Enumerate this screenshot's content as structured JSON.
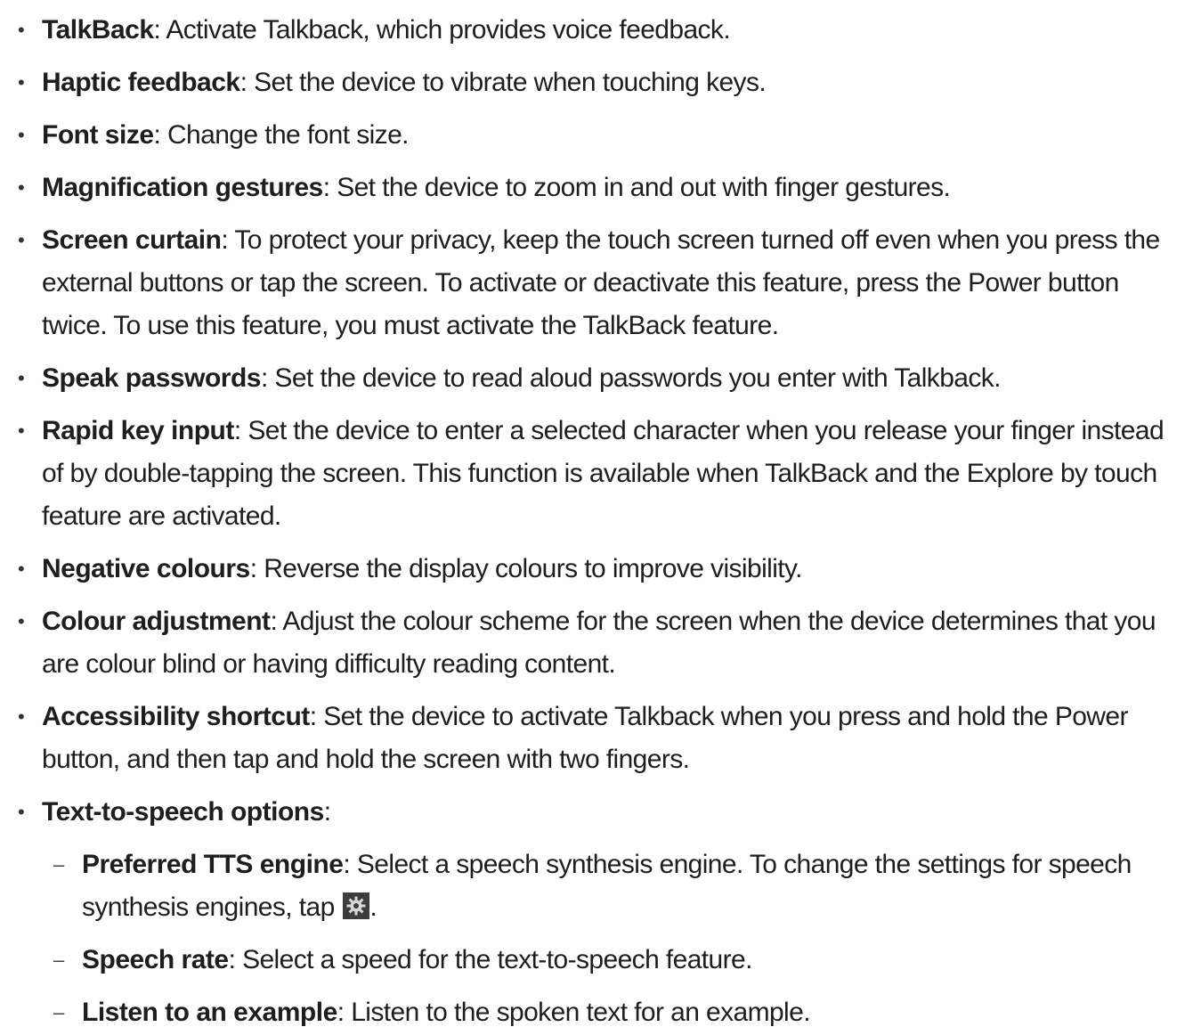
{
  "items": [
    {
      "term": "TalkBack",
      "text": ": Activate Talkback, which provides voice feedback."
    },
    {
      "term": "Haptic feedback",
      "text": ": Set the device to vibrate when touching keys."
    },
    {
      "term": "Font size",
      "text": ": Change the font size."
    },
    {
      "term": "Magnification gestures",
      "text": ": Set the device to zoom in and out with finger gestures."
    },
    {
      "term": "Screen curtain",
      "text": ": To protect your privacy, keep the touch screen turned off even when you press the external buttons or tap the screen. To activate or deactivate this feature, press the Power button twice. To use this feature, you must activate the TalkBack feature."
    },
    {
      "term": "Speak passwords",
      "text": ": Set the device to read aloud passwords you enter with Talkback."
    },
    {
      "term": "Rapid key input",
      "text": ": Set the device to enter a selected character when you release your finger instead of by double-tapping the screen. This function is available when TalkBack and the Explore by touch feature are activated."
    },
    {
      "term": "Negative colours",
      "text": ": Reverse the display colours to improve visibility."
    },
    {
      "term": "Colour adjustment",
      "text": ": Adjust the colour scheme for the screen when the device determines that you are colour blind or having difficulty reading content."
    },
    {
      "term": "Accessibility shortcut",
      "text": ": Set the device to activate Talkback when you press and hold the Power button, and then tap and hold the screen with two fingers."
    },
    {
      "term": "Text-to-speech options",
      "text": ":"
    }
  ],
  "subitems": [
    {
      "term": "Preferred TTS engine",
      "text": ": Select a speech synthesis engine. To change the settings for speech synthesis engines, tap ",
      "icon": "settings-gear-icon",
      "after_icon": "."
    },
    {
      "term": "Speech rate",
      "text": ": Select a speed for the text-to-speech feature."
    },
    {
      "term": "Listen to an example",
      "text": ": Listen to the spoken text for an example."
    }
  ],
  "bullet_char": "•",
  "dash_char": "–"
}
